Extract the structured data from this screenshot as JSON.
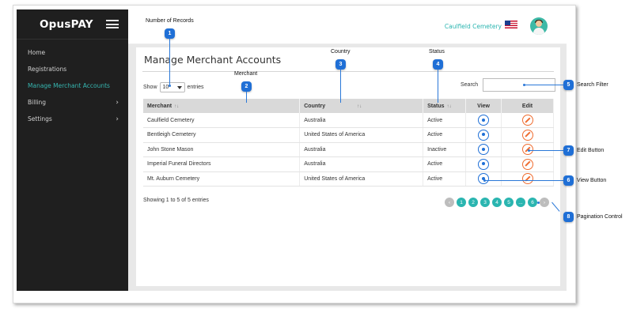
{
  "sidebar": {
    "brand": "OpusPAY",
    "items": [
      {
        "label": "Home",
        "chev": ""
      },
      {
        "label": "Registrations",
        "chev": ""
      },
      {
        "label": "Manage Merchant Accounts",
        "chev": ""
      },
      {
        "label": "Billing",
        "chev": "›"
      },
      {
        "label": "Settings",
        "chev": "›"
      }
    ]
  },
  "topbar": {
    "org": "Caulfield Cemetery"
  },
  "page": {
    "title": "Manage Merchant Accounts",
    "show_label": "Show",
    "show_value": "10",
    "entries_label": "entries",
    "search_label": "Search",
    "info": "Showing 1 to 5 of 5 entries"
  },
  "table": {
    "headers": [
      "Merchant",
      "Country",
      "Status",
      "View",
      "Edit"
    ],
    "rows": [
      {
        "merchant": "Caulfield Cemetery",
        "country": "Australia",
        "status": "Active"
      },
      {
        "merchant": "Bentleigh Cemetery",
        "country": "United States of America",
        "status": "Active"
      },
      {
        "merchant": "John Stone Mason",
        "country": "Australia",
        "status": "Inactive"
      },
      {
        "merchant": "Imperial Funeral Directors",
        "country": "Australia",
        "status": "Active"
      },
      {
        "merchant": "Mt. Auburn Cemetery",
        "country": "United States of America",
        "status": "Active"
      }
    ]
  },
  "pager": {
    "prev": "‹",
    "pages": [
      "1",
      "2",
      "3",
      "4",
      "5",
      "...",
      "6"
    ],
    "next": "›"
  },
  "callouts": {
    "c1": {
      "num": "1",
      "label": "Number of Records"
    },
    "c2": {
      "num": "2",
      "label": "Merchant"
    },
    "c3": {
      "num": "3",
      "label": "Country"
    },
    "c4": {
      "num": "4",
      "label": "Status"
    },
    "c5": {
      "num": "5",
      "label": "Search Filter"
    },
    "c6": {
      "num": "6",
      "label": "View Button"
    },
    "c7": {
      "num": "7",
      "label": "Edit Button"
    },
    "c8": {
      "num": "8",
      "label": "Pagination Control"
    }
  },
  "colors": {
    "accent": "#2ab5b0",
    "view": "#1f6fd6",
    "edit": "#ef6c2f",
    "callout": "#1f6fd6"
  }
}
